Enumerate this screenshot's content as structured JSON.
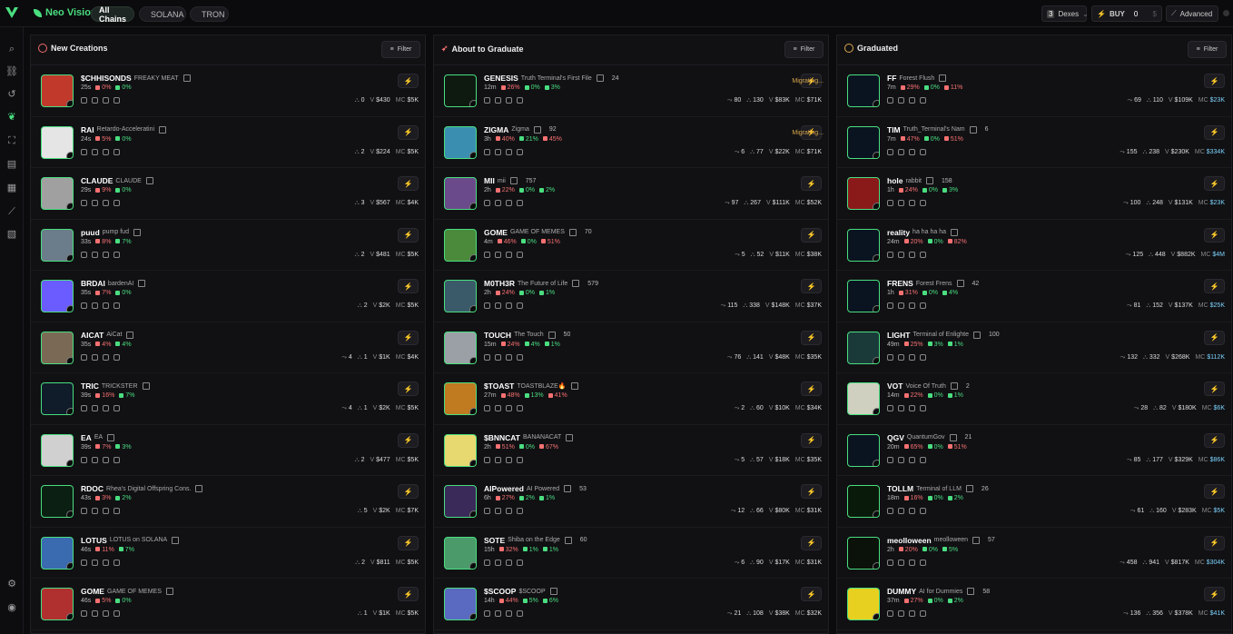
{
  "brand": {
    "name": "Neo Vision"
  },
  "chains": [
    {
      "label": "All Chains",
      "active": true
    },
    {
      "label": "SOLANA",
      "active": false,
      "color": "#6b5cff"
    },
    {
      "label": "TRON",
      "active": false,
      "color": "#ef4444"
    }
  ],
  "top_right": {
    "dexes_count": "3",
    "dexes_label": "Dexes",
    "buy_label": "BUY",
    "buy_value": "0",
    "advanced_label": "Advanced"
  },
  "sidebar": [
    "search-icon",
    "link-icon",
    "history-icon",
    "leaf-icon",
    "scan-icon",
    "wallet-icon",
    "book-icon",
    "chart-icon",
    "document-icon",
    "settings-icon",
    "user-icon"
  ],
  "panels": [
    {
      "title": "New Creations",
      "filter_label": "Filter",
      "tokens": [
        {
          "sym": "$CHHISONDS",
          "name": "FREAKY MEAT",
          "age": "25s",
          "p1": "0%",
          "p2": "0%",
          "p3": "",
          "holders": "0",
          "vol": "$430",
          "mc": "$5K",
          "c": "#c0392b",
          "txn": ""
        },
        {
          "sym": "RAI",
          "name": "Retardo-Acceleratini",
          "age": "24s",
          "p1": "5%",
          "p2": "0%",
          "p3": "",
          "holders": "2",
          "vol": "$224",
          "mc": "$5K",
          "c": "#e5e5e5",
          "txn": ""
        },
        {
          "sym": "CLAUDE",
          "name": "CLAUDE",
          "age": "29s",
          "p1": "9%",
          "p2": "0%",
          "p3": "",
          "holders": "3",
          "vol": "$567",
          "mc": "$4K",
          "c": "#a0a0a0",
          "txn": ""
        },
        {
          "sym": "puud",
          "name": "pump fud",
          "age": "33s",
          "p1": "8%",
          "p2": "7%",
          "p3": "",
          "holders": "2",
          "vol": "$481",
          "mc": "$5K",
          "c": "#6b7c8a",
          "txn": ""
        },
        {
          "sym": "BRDAI",
          "name": "bardenAI",
          "age": "35s",
          "p1": "7%",
          "p2": "0%",
          "p3": "",
          "holders": "2",
          "vol": "$2K",
          "mc": "$5K",
          "c": "#6b5cff",
          "txn": ""
        },
        {
          "sym": "AICAT",
          "name": "AiCat",
          "age": "35s",
          "p1": "4%",
          "p2": "4%",
          "p3": "",
          "holders": "1",
          "vol": "$1K",
          "mc": "$4K",
          "c": "#7a6a55",
          "txn": "4"
        },
        {
          "sym": "TRIC",
          "name": "TRICKSTER",
          "age": "39s",
          "p1": "16%",
          "p2": "7%",
          "p3": "",
          "holders": "1",
          "vol": "$2K",
          "mc": "$5K",
          "c": "#101c2a",
          "txn": "4"
        },
        {
          "sym": "EA",
          "name": "EA",
          "age": "39s",
          "p1": "7%",
          "p2": "3%",
          "p3": "",
          "holders": "2",
          "vol": "$477",
          "mc": "$5K",
          "c": "#d0d0d0",
          "txn": ""
        },
        {
          "sym": "RDOC",
          "name": "Rhea's Digital Offspring Cons.",
          "age": "43s",
          "p1": "3%",
          "p2": "2%",
          "p3": "",
          "holders": "5",
          "vol": "$2K",
          "mc": "$7K",
          "c": "#0b1f12",
          "txn": ""
        },
        {
          "sym": "LOTUS",
          "name": "LOTUS on SOLANA",
          "age": "46s",
          "p1": "11%",
          "p2": "7%",
          "p3": "",
          "holders": "2",
          "vol": "$811",
          "mc": "$5K",
          "c": "#3a6ab0",
          "txn": ""
        },
        {
          "sym": "GOME",
          "name": "GAME OF MEMES",
          "age": "46s",
          "p1": "5%",
          "p2": "0%",
          "p3": "",
          "holders": "1",
          "vol": "$1K",
          "mc": "$5K",
          "c": "#b03030",
          "txn": ""
        }
      ]
    },
    {
      "title": "About to Graduate",
      "filter_label": "Filter",
      "tokens": [
        {
          "sym": "GENESIS",
          "name": "Truth Terminal's First File",
          "hold": "24",
          "age": "12m",
          "p1": "26%",
          "p2": "0%",
          "p3": "3%",
          "holders": "130",
          "txn": "80",
          "vol": "$83K",
          "mc": "$71K",
          "c": "#0e1a10",
          "mig": "Migrating..."
        },
        {
          "sym": "ZIGMA",
          "name": "Zigma",
          "hold": "92",
          "age": "3h",
          "p1": "40%",
          "p2": "21%",
          "p3": "45%",
          "holders": "77",
          "txn": "6",
          "vol": "$22K",
          "mc": "$71K",
          "c": "#3a8fb0",
          "mig": "Migrating..."
        },
        {
          "sym": "MII",
          "name": "mii",
          "hold": "757",
          "age": "2h",
          "p1": "22%",
          "p2": "0%",
          "p3": "2%",
          "holders": "267",
          "txn": "97",
          "vol": "$111K",
          "mc": "$52K",
          "c": "#6a4a8a",
          "mig": ""
        },
        {
          "sym": "GOME",
          "name": "GAME OF MEMES",
          "hold": "70",
          "age": "4m",
          "p1": "46%",
          "p2": "0%",
          "p3": "51%",
          "holders": "52",
          "txn": "5",
          "vol": "$11K",
          "mc": "$38K",
          "c": "#4a8a3a",
          "mig": ""
        },
        {
          "sym": "M0TH3R",
          "name": "The Future of Life",
          "hold": "579",
          "age": "2h",
          "p1": "24%",
          "p2": "0%",
          "p3": "1%",
          "holders": "338",
          "txn": "115",
          "vol": "$148K",
          "mc": "$37K",
          "c": "#3a5a6a",
          "mig": ""
        },
        {
          "sym": "TOUCH",
          "name": "The Touch",
          "hold": "50",
          "age": "15m",
          "p1": "24%",
          "p2": "4%",
          "p3": "1%",
          "holders": "141",
          "txn": "76",
          "vol": "$48K",
          "mc": "$35K",
          "c": "#9aa0a6",
          "mig": ""
        },
        {
          "sym": "$TOAST",
          "name": "TOASTBLAZE🔥",
          "hold": "",
          "age": "27m",
          "p1": "48%",
          "p2": "13%",
          "p3": "41%",
          "holders": "60",
          "txn": "2",
          "vol": "$10K",
          "mc": "$34K",
          "c": "#c07a20",
          "mig": ""
        },
        {
          "sym": "$BNNCAT",
          "name": "BANANACAT",
          "hold": "",
          "age": "2h",
          "p1": "51%",
          "p2": "0%",
          "p3": "67%",
          "holders": "57",
          "txn": "5",
          "vol": "$18K",
          "mc": "$35K",
          "c": "#e8d870",
          "mig": ""
        },
        {
          "sym": "AIPowered",
          "name": "AI Powered",
          "hold": "53",
          "age": "6h",
          "p1": "27%",
          "p2": "2%",
          "p3": "1%",
          "holders": "66",
          "txn": "12",
          "vol": "$80K",
          "mc": "$31K",
          "c": "#3a2a5a",
          "mig": ""
        },
        {
          "sym": "SOTE",
          "name": "Shiba on the Edge",
          "hold": "60",
          "age": "15h",
          "p1": "32%",
          "p2": "1%",
          "p3": "1%",
          "holders": "90",
          "txn": "6",
          "vol": "$17K",
          "mc": "$31K",
          "c": "#4a9a6a",
          "mig": ""
        },
        {
          "sym": "$SCOOP",
          "name": "$SCOOP",
          "hold": "",
          "age": "14h",
          "p1": "44%",
          "p2": "5%",
          "p3": "6%",
          "holders": "108",
          "txn": "21",
          "vol": "$38K",
          "mc": "$32K",
          "c": "#5a6ac0",
          "mig": ""
        }
      ]
    },
    {
      "title": "Graduated",
      "filter_label": "Filter",
      "tokens": [
        {
          "sym": "FF",
          "name": "Forest Flush",
          "hold": "",
          "age": "7m",
          "p1": "29%",
          "p2": "0%",
          "p3": "11%",
          "holders": "110",
          "txn": "69",
          "vol": "$109K",
          "mc": "$23K",
          "c": "#0a1420"
        },
        {
          "sym": "TIM",
          "name": "Truth_Terminal's Nam",
          "hold": "6",
          "age": "7m",
          "p1": "47%",
          "p2": "0%",
          "p3": "51%",
          "holders": "238",
          "txn": "155",
          "vol": "$230K",
          "mc": "$334K",
          "c": "#0a1420"
        },
        {
          "sym": "hole",
          "name": "rabbit",
          "hold": "158",
          "age": "1h",
          "p1": "24%",
          "p2": "0%",
          "p3": "3%",
          "holders": "248",
          "txn": "100",
          "vol": "$131K",
          "mc": "$23K",
          "c": "#8a1a1a"
        },
        {
          "sym": "reality",
          "name": "ha ha ha ha",
          "hold": "",
          "age": "24m",
          "p1": "20%",
          "p2": "0%",
          "p3": "82%",
          "holders": "448",
          "txn": "125",
          "vol": "$882K",
          "mc": "$4M",
          "c": "#0a1420"
        },
        {
          "sym": "FRENS",
          "name": "Forest Frens",
          "hold": "42",
          "age": "1h",
          "p1": "31%",
          "p2": "0%",
          "p3": "4%",
          "holders": "152",
          "txn": "81",
          "vol": "$137K",
          "mc": "$25K",
          "c": "#0a1420"
        },
        {
          "sym": "LIGHT",
          "name": "Terminal of Enlighte",
          "hold": "100",
          "age": "49m",
          "p1": "25%",
          "p2": "3%",
          "p3": "1%",
          "holders": "332",
          "txn": "132",
          "vol": "$268K",
          "mc": "$112K",
          "c": "#1a3a3a"
        },
        {
          "sym": "VOT",
          "name": "Voice Of Truth",
          "hold": "2",
          "age": "14m",
          "p1": "22%",
          "p2": "0%",
          "p3": "1%",
          "holders": "82",
          "txn": "28",
          "vol": "$180K",
          "mc": "$6K",
          "c": "#d0d0c0"
        },
        {
          "sym": "QGV",
          "name": "QuantumGov",
          "hold": "21",
          "age": "20m",
          "p1": "65%",
          "p2": "0%",
          "p3": "51%",
          "holders": "177",
          "txn": "85",
          "vol": "$329K",
          "mc": "$86K",
          "c": "#0a1420"
        },
        {
          "sym": "TOLLM",
          "name": "Terminal of LLM",
          "hold": "26",
          "age": "18m",
          "p1": "16%",
          "p2": "0%",
          "p3": "2%",
          "holders": "160",
          "txn": "61",
          "vol": "$283K",
          "mc": "$5K",
          "c": "#0a1a0a"
        },
        {
          "sym": "meolloween",
          "name": "meolloween",
          "hold": "57",
          "age": "2h",
          "p1": "20%",
          "p2": "0%",
          "p3": "5%",
          "holders": "941",
          "txn": "458",
          "vol": "$817K",
          "mc": "$304K",
          "c": "#0a120a"
        },
        {
          "sym": "DUMMY",
          "name": "AI for Dummies",
          "hold": "58",
          "age": "37m",
          "p1": "27%",
          "p2": "0%",
          "p3": "2%",
          "holders": "356",
          "txn": "136",
          "vol": "$378K",
          "mc": "$41K",
          "c": "#e8d020"
        }
      ]
    }
  ]
}
